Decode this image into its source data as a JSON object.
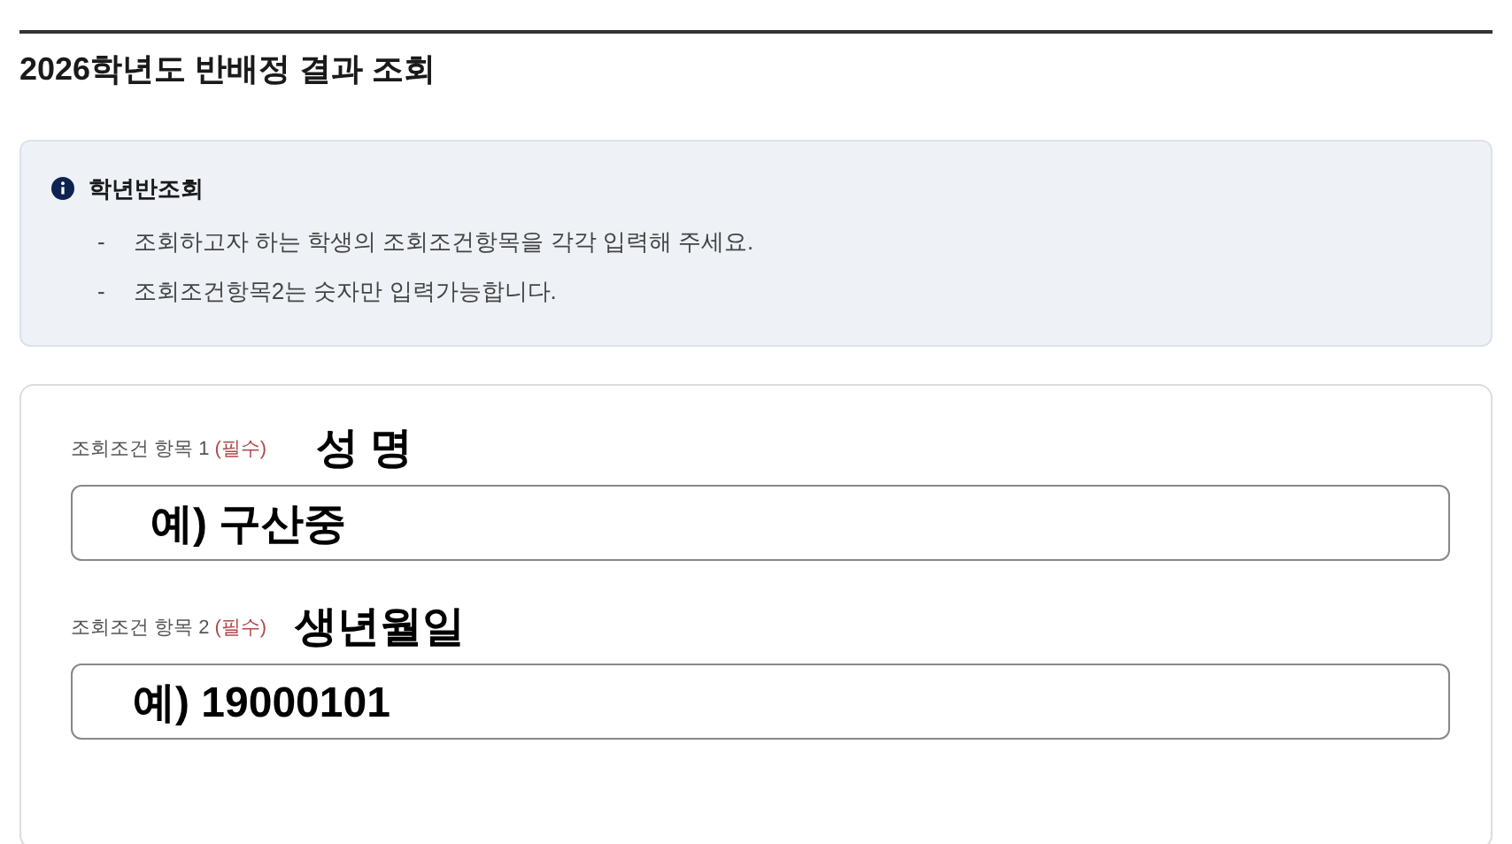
{
  "title": "2026학년도 반배정 결과 조회",
  "notice": {
    "heading": "학년반조회",
    "items": [
      {
        "bullet": "-",
        "text": "조회하고자 하는 학생의 조회조건항목을 각각 입력해 주세요."
      },
      {
        "bullet": "-",
        "text": "조회조건항목2는 숫자만 입력가능합니다."
      }
    ]
  },
  "fields": [
    {
      "label": "조회조건 항목 1",
      "required": "(필수)",
      "annotation": "성 명",
      "value": "예) 구산중"
    },
    {
      "label": "조회조건 항목 2",
      "required": "(필수)",
      "annotation": "생년월일",
      "value": "예) 19000101"
    }
  ]
}
